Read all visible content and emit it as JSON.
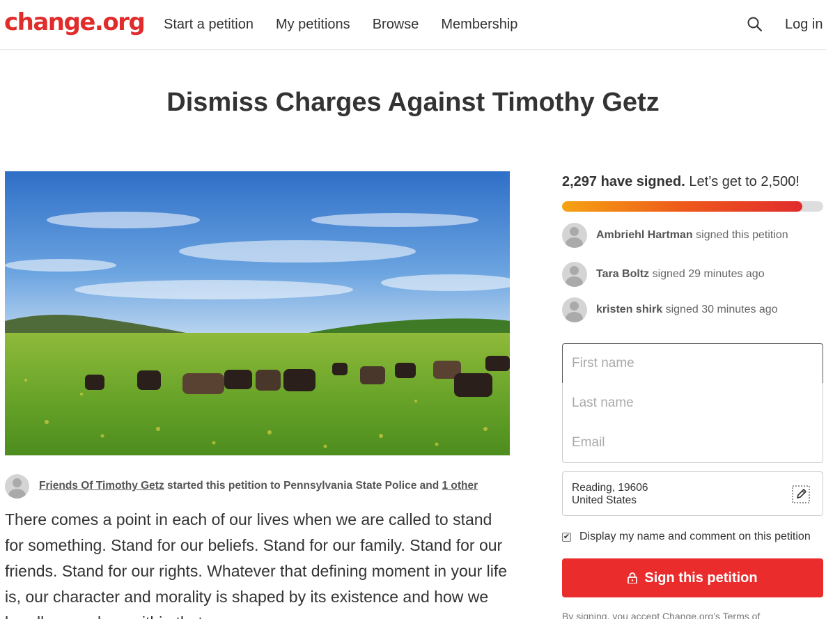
{
  "header": {
    "logo": "change.org",
    "nav": [
      "Start a petition",
      "My petitions",
      "Browse",
      "Membership"
    ],
    "search_icon": "search-icon",
    "login": "Log in"
  },
  "petition": {
    "title": "Dismiss Charges Against Timothy Getz",
    "starter_name": "Friends Of Timothy Getz",
    "starter_mid": " started this petition to Pennsylvania State Police and ",
    "starter_other": "1 other",
    "body": "There comes a point in each of our lives when we are called to stand for something. Stand for our beliefs. Stand for our family. Stand for our friends. Stand for our rights. Whatever that defining moment in your life is, our character and morality is shaped by its existence and how we handle ourselves within that"
  },
  "sidebar": {
    "signed_count": "2,297 have signed.",
    "goal_text": " Let’s get to 2,500!",
    "progress_fraction": 0.9188,
    "signers": [
      {
        "name": "Ambriehl Hartman",
        "action": " signed this petition"
      },
      {
        "name": "Tara Boltz",
        "action": " signed 29 minutes ago"
      },
      {
        "name": "kristen shirk",
        "action": " signed 30 minutes ago"
      }
    ],
    "form": {
      "first_name_placeholder": "First name",
      "last_name_placeholder": "Last name",
      "email_placeholder": "Email",
      "location_line1": "Reading, 19606",
      "location_line2": "United States",
      "display_label": "Display my name and comment on this petition",
      "display_checked": true,
      "sign_button": "Sign this petition",
      "terms": "By signing, you accept Change.org’s Terms of"
    }
  },
  "colors": {
    "brand": "#e12c2c",
    "button": "#ea2c2c",
    "progress_start": "#f5a313",
    "progress_end": "#e12c2c"
  }
}
